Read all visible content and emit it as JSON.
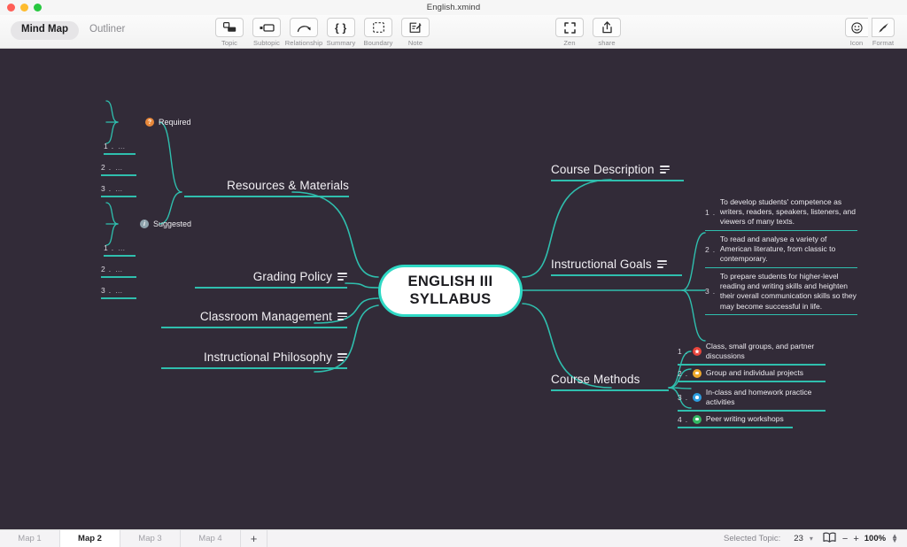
{
  "window": {
    "document_title": "English.xmind"
  },
  "toolbar": {
    "modes": [
      {
        "label": "Mind Map",
        "active": true
      },
      {
        "label": "Outliner",
        "active": false
      }
    ],
    "tools": [
      {
        "label": "Topic",
        "icon": "topic-icon"
      },
      {
        "label": "Subtopic",
        "icon": "subtopic-icon"
      },
      {
        "label": "Relationship",
        "icon": "relationship-icon"
      },
      {
        "label": "Summary",
        "icon": "summary-icon"
      },
      {
        "label": "Boundary",
        "icon": "boundary-icon"
      },
      {
        "label": "Note",
        "icon": "note-icon"
      }
    ],
    "zen": {
      "label": "Zen",
      "icon": "zen-icon"
    },
    "share": {
      "label": "share",
      "icon": "share-icon"
    },
    "icon_btn": {
      "label": "Icon",
      "icon": "smiley-icon"
    },
    "format_btn": {
      "label": "Format",
      "icon": "format-brush-icon"
    }
  },
  "mindmap": {
    "accent_color": "#2fbfae",
    "central_border_color": "#2fd9c5",
    "canvas_background": "#322b38",
    "central_topic": {
      "line1": "ENGLISH III",
      "line2": "SYLLABUS"
    },
    "left_branches": [
      {
        "label": "Resources & Materials",
        "has_note": false
      },
      {
        "label": "Grading Policy",
        "has_note": true
      },
      {
        "label": "Classroom Management",
        "has_note": true
      },
      {
        "label": "Instructional Philosophy",
        "has_note": true
      }
    ],
    "resource_groups": [
      {
        "label": "Required",
        "badge_color": "#e8883a",
        "badge_glyph": "?",
        "items": [
          {
            "num": "1 .",
            "text": "…"
          },
          {
            "num": "2 .",
            "text": "…"
          },
          {
            "num": "3 .",
            "text": "…"
          }
        ]
      },
      {
        "label": "Suggested",
        "badge_color": "#8fa3ad",
        "badge_glyph": "i",
        "items": [
          {
            "num": "1 .",
            "text": "…"
          },
          {
            "num": "2 .",
            "text": "…"
          },
          {
            "num": "3 .",
            "text": "…"
          }
        ]
      }
    ],
    "right_branches": [
      {
        "label": "Course Description",
        "has_note": true
      },
      {
        "label": "Instructional Goals",
        "has_note": true
      },
      {
        "label": "Course Methods",
        "has_note": false
      }
    ],
    "instructional_goals": [
      {
        "num": "1 .",
        "text": "To develop students' competence as writers, readers, speakers, listeners, and viewers of many texts."
      },
      {
        "num": "2 .",
        "text": "To read and analyse a variety of American literature, from classic to contemporary."
      },
      {
        "num": "3 .",
        "text": "To prepare students for higher-level reading and writing skills and heighten their overall communication skills so they may become successful in life."
      }
    ],
    "course_methods": [
      {
        "num": "1 .",
        "text": "Class, small groups, and partner discussions",
        "badge_color": "#e8453c",
        "badge_icon": "star-badge-icon"
      },
      {
        "num": "2 .",
        "text": "Group and individual projects",
        "badge_color": "#f0a92c",
        "badge_icon": "dot-badge-icon"
      },
      {
        "num": "3 .",
        "text": "In-class and homework practice activities",
        "badge_color": "#2e9fe0",
        "badge_icon": "dot-badge-icon"
      },
      {
        "num": "4 .",
        "text": "Peer writing workshops",
        "badge_color": "#34b863",
        "badge_icon": "dot-badge-icon"
      }
    ]
  },
  "statusbar": {
    "map_tabs": [
      {
        "label": "Map 1",
        "active": false
      },
      {
        "label": "Map 2",
        "active": true
      },
      {
        "label": "Map 3",
        "active": false
      },
      {
        "label": "Map 4",
        "active": false
      }
    ],
    "add_tab": "+",
    "selected_topic_label": "Selected Topic:",
    "selected_topic_count": "23",
    "zoom_minus": "−",
    "zoom_plus": "+",
    "zoom_level": "100%"
  }
}
